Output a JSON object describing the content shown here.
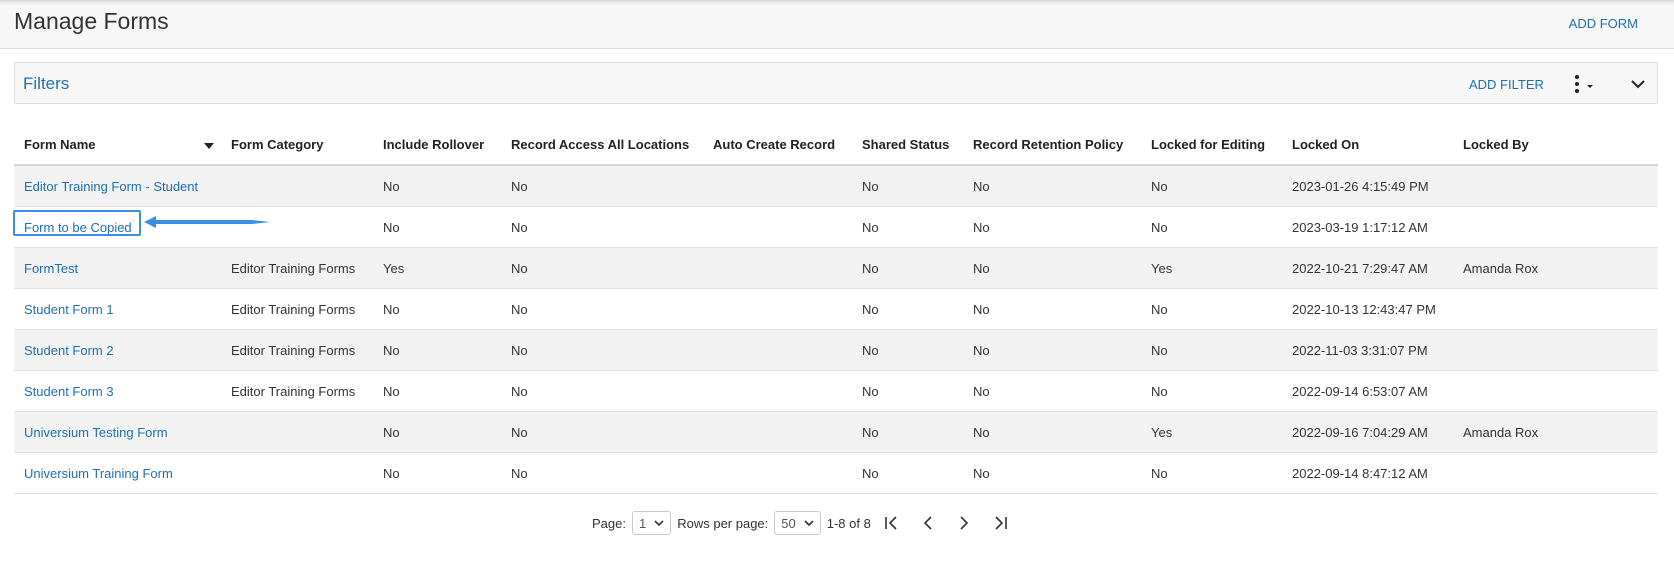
{
  "header": {
    "title": "Manage Forms",
    "add_form_label": "ADD FORM"
  },
  "filters": {
    "title": "Filters",
    "add_filter_label": "ADD FILTER"
  },
  "table": {
    "columns": [
      "Form Name",
      "Form Category",
      "Include Rollover",
      "Record Access All Locations",
      "Auto Create Record",
      "Shared Status",
      "Record Retention Policy",
      "Locked for Editing",
      "Locked On",
      "Locked By"
    ],
    "rows": [
      [
        "Editor Training Form - Student",
        "",
        "No",
        "No",
        "",
        "No",
        "No",
        "No",
        "2023-01-26 4:15:49 PM",
        ""
      ],
      [
        "Form to be Copied",
        "",
        "No",
        "No",
        "",
        "No",
        "No",
        "No",
        "2023-03-19 1:17:12 AM",
        ""
      ],
      [
        "FormTest",
        "Editor Training Forms",
        "Yes",
        "No",
        "",
        "No",
        "No",
        "Yes",
        "2022-10-21 7:29:47 AM",
        "Amanda Rox"
      ],
      [
        "Student Form 1",
        "Editor Training Forms",
        "No",
        "No",
        "",
        "No",
        "No",
        "No",
        "2022-10-13 12:43:47 PM",
        ""
      ],
      [
        "Student Form 2",
        "Editor Training Forms",
        "No",
        "No",
        "",
        "No",
        "No",
        "No",
        "2022-11-03 3:31:07 PM",
        ""
      ],
      [
        "Student Form 3",
        "Editor Training Forms",
        "No",
        "No",
        "",
        "No",
        "No",
        "No",
        "2022-09-14 6:53:07 AM",
        ""
      ],
      [
        "Universium Testing Form",
        "",
        "No",
        "No",
        "",
        "No",
        "No",
        "Yes",
        "2022-09-16 7:04:29 AM",
        "Amanda Rox"
      ],
      [
        "Universium Training Form",
        "",
        "No",
        "No",
        "",
        "No",
        "No",
        "No",
        "2022-09-14 8:47:12 AM",
        ""
      ]
    ]
  },
  "pagination": {
    "page_label": "Page:",
    "page_value": "1",
    "rows_label": "Rows per page:",
    "rows_value": "50",
    "range_text": "1-8 of 8"
  },
  "colors": {
    "link": "#1f6fb2",
    "highlight": "#3a8fe0",
    "row_alt": "#f2f2f2"
  },
  "icons": [
    "sort-down-icon",
    "kebab-menu-icon",
    "chevron-down-icon",
    "first-page-icon",
    "prev-page-icon",
    "next-page-icon",
    "last-page-icon"
  ]
}
